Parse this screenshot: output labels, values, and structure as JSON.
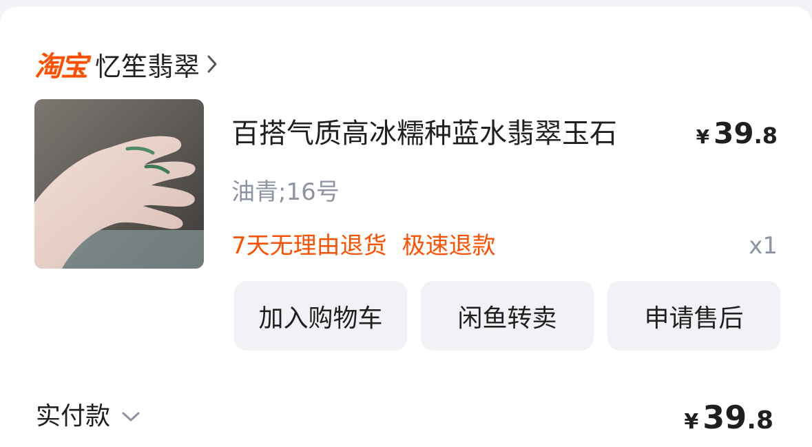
{
  "shop": {
    "brand": "淘宝",
    "name": "忆笙翡翠"
  },
  "item": {
    "title": "百搭气质高冰糯种蓝水翡翠玉石",
    "price": {
      "currency": "¥",
      "integer": "39",
      "decimal": ".8"
    },
    "sku": "油青;16号",
    "services": [
      "7天无理由退货",
      "极速退款"
    ],
    "quantity": "x1"
  },
  "actions": {
    "add_to_cart": "加入购物车",
    "resell": "闲鱼转卖",
    "after_sale": "申请售后"
  },
  "payment": {
    "label": "实付款",
    "price": {
      "currency": "¥",
      "integer": "39",
      "decimal": ".8"
    }
  },
  "colors": {
    "brand": "#ff5000",
    "text": "#1f1f1f",
    "muted": "#8d93a3",
    "button_bg": "#f0f2f5"
  },
  "icons": {
    "shop_chevron": "chevron-right-icon",
    "payment_chevron": "chevron-down-icon"
  }
}
